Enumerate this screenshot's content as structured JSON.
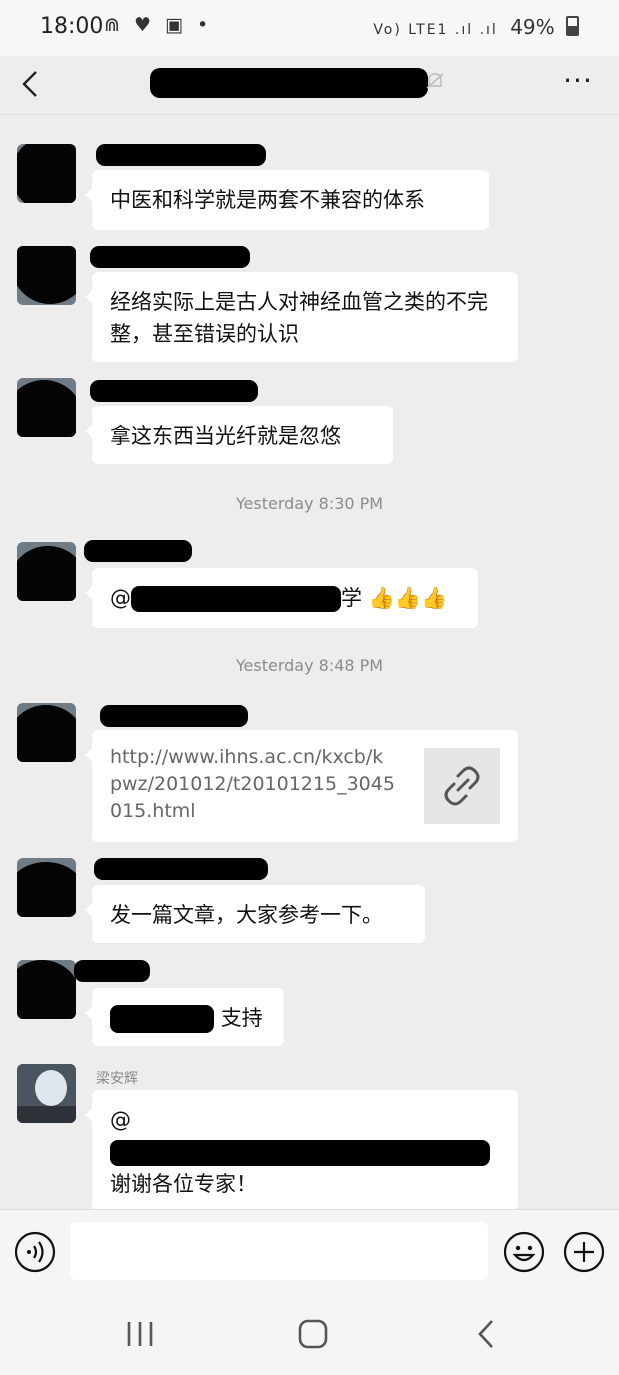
{
  "status_bar": {
    "time": "18:00",
    "icons_left": "⋒ ♥ ▣ •",
    "signal": "Vo) LTE1 .ıl .ıl",
    "battery": "49%"
  },
  "header": {
    "more_label": "···"
  },
  "messages": [
    {
      "text": "中医和科学就是两套不兼容的体系"
    },
    {
      "text": "经络实际上是古人对神经血管之类的不完整，甚至错误的认识"
    },
    {
      "text": "拿这东西当光纤就是忽悠"
    },
    {
      "timestamp": "Yesterday 8:30 PM"
    },
    {
      "prefix": "@",
      "suffix": "学",
      "emoji": "👍👍👍"
    },
    {
      "timestamp": "Yesterday 8:48 PM"
    },
    {
      "link": "http://www.ihns.ac.cn/kxcb/kpwz/201012/t20101215_3045015.html"
    },
    {
      "text": "发一篇文章，大家参考一下。"
    },
    {
      "text": "支持"
    },
    {
      "name": "梁安辉",
      "prefix": "@",
      "last_line": "谢谢各位专家！"
    }
  ],
  "input": {
    "placeholder": ""
  }
}
